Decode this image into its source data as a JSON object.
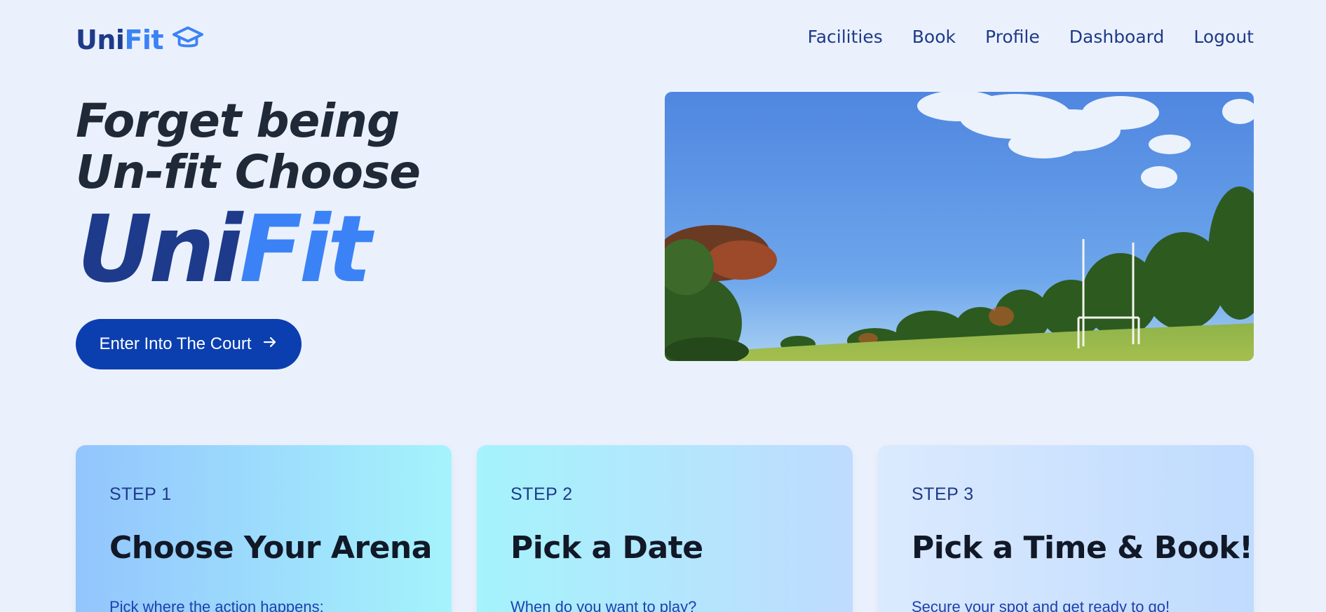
{
  "brand": {
    "part1": "Uni",
    "part2": "Fit",
    "icon": "graduation-cap-icon"
  },
  "nav": {
    "items": [
      "Facilities",
      "Book",
      "Profile",
      "Dashboard",
      "Logout"
    ]
  },
  "hero": {
    "line1": "Forget being",
    "line2": "Un-fit Choose",
    "brand_part1": "Uni",
    "brand_part2": "Fit",
    "cta_label": "Enter Into The Court",
    "cta_icon": "arrow-right-icon",
    "image": "sports-field-with-rugby-goalposts-photo"
  },
  "steps": [
    {
      "label": "STEP 1",
      "title": "Choose Your Arena",
      "desc": "Pick where the action happens:"
    },
    {
      "label": "STEP 2",
      "title": "Pick a Date",
      "desc": "When do you want to play?"
    },
    {
      "label": "STEP 3",
      "title": "Pick a Time & Book!",
      "desc": "Secure your spot and get ready to go!"
    }
  ],
  "colors": {
    "background": "#ebf1fc",
    "brand_dark": "#1e3a8a",
    "brand_light": "#3b82f6",
    "cta": "#0b3fb0"
  }
}
